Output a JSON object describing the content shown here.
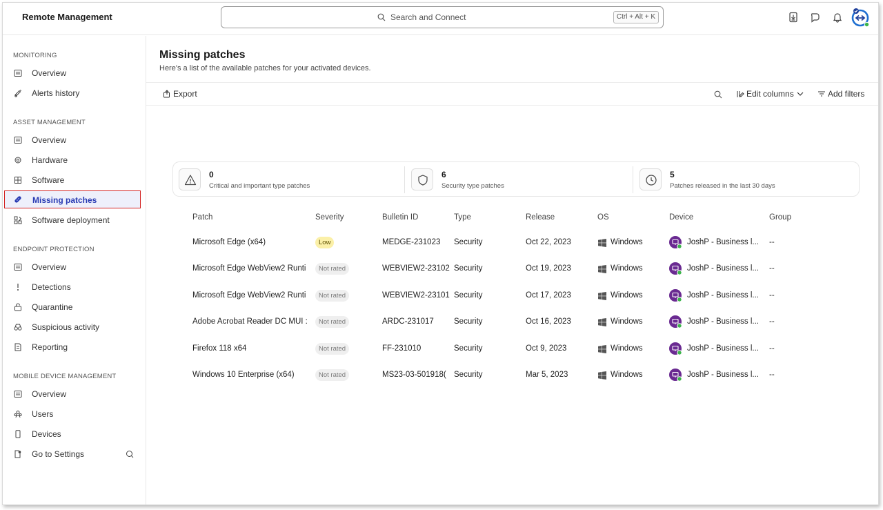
{
  "app": {
    "title": "Remote Management"
  },
  "search": {
    "placeholder": "Search and Connect",
    "shortcut": "Ctrl + Alt + K"
  },
  "sidebar": {
    "sections": [
      {
        "title": "MONITORING",
        "items": [
          {
            "label": "Overview",
            "icon": "dashboard-icon"
          },
          {
            "label": "Alerts history",
            "icon": "alert-bell-icon"
          }
        ]
      },
      {
        "title": "ASSET MANAGEMENT",
        "items": [
          {
            "label": "Overview",
            "icon": "dashboard-icon"
          },
          {
            "label": "Hardware",
            "icon": "chip-icon"
          },
          {
            "label": "Software",
            "icon": "grid-icon"
          },
          {
            "label": "Missing patches",
            "icon": "patch-icon",
            "active": true
          },
          {
            "label": "Software deployment",
            "icon": "deploy-icon"
          }
        ]
      },
      {
        "title": "ENDPOINT PROTECTION",
        "items": [
          {
            "label": "Overview",
            "icon": "dashboard-icon"
          },
          {
            "label": "Detections",
            "icon": "detection-icon"
          },
          {
            "label": "Quarantine",
            "icon": "quarantine-icon"
          },
          {
            "label": "Suspicious activity",
            "icon": "binoculars-icon"
          },
          {
            "label": "Reporting",
            "icon": "report-icon"
          }
        ]
      },
      {
        "title": "MOBILE DEVICE MANAGEMENT",
        "items": [
          {
            "label": "Overview",
            "icon": "dashboard-icon"
          },
          {
            "label": "Users",
            "icon": "users-icon"
          },
          {
            "label": "Devices",
            "icon": "mobile-icon"
          },
          {
            "label": "Go to Settings",
            "icon": "settings-icon"
          }
        ]
      }
    ]
  },
  "main": {
    "title": "Missing patches",
    "subtitle": "Here's a list of the available patches for your activated devices.",
    "toolbar": {
      "export": "Export",
      "edit_columns": "Edit columns",
      "add_filters": "Add filters"
    },
    "summary": [
      {
        "value": "0",
        "label": "Critical and important type patches",
        "icon": "warning-icon"
      },
      {
        "value": "6",
        "label": "Security type patches",
        "icon": "shield-icon"
      },
      {
        "value": "5",
        "label": "Patches released in the last 30 days",
        "icon": "clock-icon"
      }
    ],
    "columns": [
      "Patch",
      "Severity",
      "Bulletin ID",
      "Type",
      "Release",
      "OS",
      "Device",
      "Group"
    ],
    "rows": [
      {
        "patch": "Microsoft Edge (x64)",
        "severity": "Low",
        "bulletin": "MEDGE-231023",
        "type": "Security",
        "release": "Oct 22, 2023",
        "os": "Windows",
        "device": "JoshP - Business l...",
        "group": "--"
      },
      {
        "patch": "Microsoft Edge WebView2 Runti",
        "severity": "Not rated",
        "bulletin": "WEBVIEW2-23102",
        "type": "Security",
        "release": "Oct 19, 2023",
        "os": "Windows",
        "device": "JoshP - Business l...",
        "group": "--"
      },
      {
        "patch": "Microsoft Edge WebView2 Runti",
        "severity": "Not rated",
        "bulletin": "WEBVIEW2-23101",
        "type": "Security",
        "release": "Oct 17, 2023",
        "os": "Windows",
        "device": "JoshP - Business l...",
        "group": "--"
      },
      {
        "patch": "Adobe Acrobat Reader DC MUI :",
        "severity": "Not rated",
        "bulletin": "ARDC-231017",
        "type": "Security",
        "release": "Oct 16, 2023",
        "os": "Windows",
        "device": "JoshP - Business l...",
        "group": "--"
      },
      {
        "patch": "Firefox 118 x64",
        "severity": "Not rated",
        "bulletin": "FF-231010",
        "type": "Security",
        "release": "Oct 9, 2023",
        "os": "Windows",
        "device": "JoshP - Business l...",
        "group": "--"
      },
      {
        "patch": "Windows 10 Enterprise (x64)",
        "severity": "Not rated",
        "bulletin": "MS23-03-501918(",
        "type": "Security",
        "release": "Mar 5, 2023",
        "os": "Windows",
        "device": "JoshP - Business l...",
        "group": "--"
      }
    ]
  },
  "colors": {
    "accent": "#2a3bb3",
    "active_outline": "#d2201f",
    "device_purple": "#6a2a91",
    "online_green": "#3cb44a",
    "low_badge": "#fbf0a8"
  }
}
